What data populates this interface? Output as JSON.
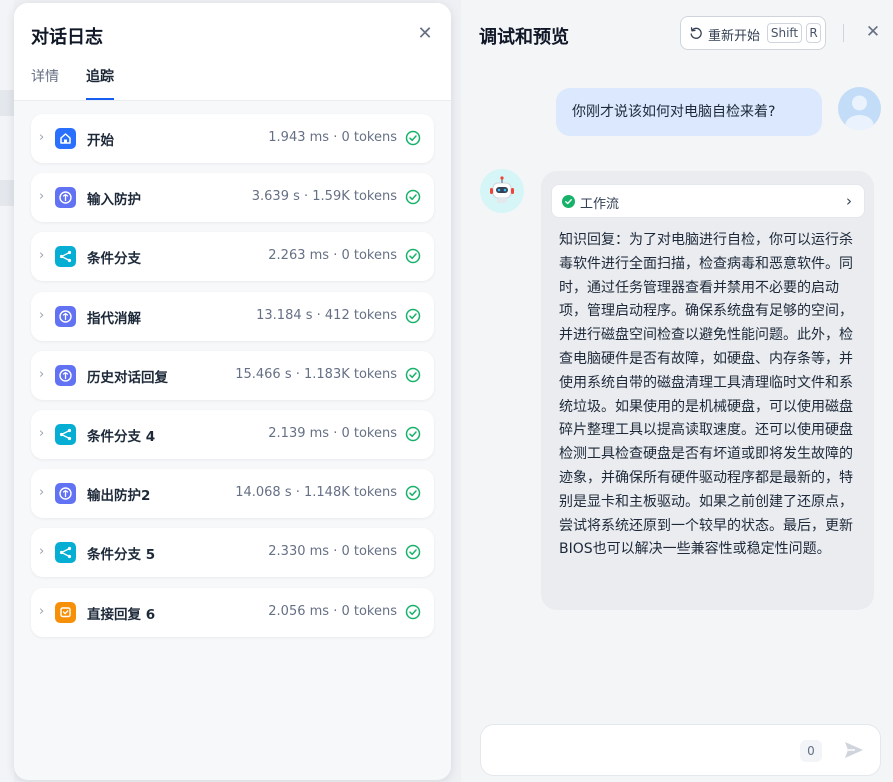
{
  "log": {
    "title": "对话日志",
    "tabs": [
      {
        "label": "详情"
      },
      {
        "label": "追踪"
      }
    ],
    "steps": [
      {
        "name": "开始",
        "meta": "1.943 ms · 0 tokens",
        "icon": "home-icon",
        "color": "#2970ff"
      },
      {
        "name": "输入防护",
        "meta": "3.639 s · 1.59K tokens",
        "icon": "shield-icon",
        "color": "#6172f3"
      },
      {
        "name": "条件分支",
        "meta": "2.263 ms · 0 tokens",
        "icon": "branch-icon",
        "color": "#06aed4"
      },
      {
        "name": "指代消解",
        "meta": "13.184 s · 412 tokens",
        "icon": "shield-icon",
        "color": "#6172f3"
      },
      {
        "name": "历史对话回复",
        "meta": "15.466 s · 1.183K tokens",
        "icon": "shield-icon",
        "color": "#6172f3"
      },
      {
        "name": "条件分支 4",
        "meta": "2.139 ms · 0 tokens",
        "icon": "branch-icon",
        "color": "#06aed4"
      },
      {
        "name": "输出防护2",
        "meta": "14.068 s · 1.148K tokens",
        "icon": "shield-icon",
        "color": "#6172f3"
      },
      {
        "name": "条件分支 5",
        "meta": "2.330 ms · 0 tokens",
        "icon": "branch-icon",
        "color": "#06aed4"
      },
      {
        "name": "直接回复 6",
        "meta": "2.056 ms · 0 tokens",
        "icon": "reply-icon",
        "color": "#f79009"
      }
    ]
  },
  "preview": {
    "title": "调试和预览",
    "restart_label": "重新开始",
    "kbd_shift": "Shift",
    "kbd_r": "R",
    "user_message": "你刚才说该如何对电脑自检来着?",
    "workflow_label": "工作流",
    "answer": "知识回复：为了对电脑进行自检，你可以运行杀毒软件进行全面扫描，检查病毒和恶意软件。同时，通过任务管理器查看并禁用不必要的启动项，管理启动程序。确保系统盘有足够的空间，并进行磁盘空间检查以避免性能问题。此外，检查电脑硬件是否有故障，如硬盘、内存条等，并使用系统自带的磁盘清理工具清理临时文件和系统垃圾。如果使用的是机械硬盘，可以使用磁盘碎片整理工具以提高读取速度。还可以使用硬盘检测工具检查硬盘是否有坏道或即将发生故障的迹象，并确保所有硬件驱动程序都是最新的，特别是显卡和主板驱动。如果之前创建了还原点，尝试将系统还原到一个较早的状态。最后，更新BIOS也可以解决一些兼容性或稳定性问题。",
    "input_value": "",
    "char_count": "0"
  },
  "colors": {
    "accent": "#155eef",
    "success": "#17b26a"
  }
}
